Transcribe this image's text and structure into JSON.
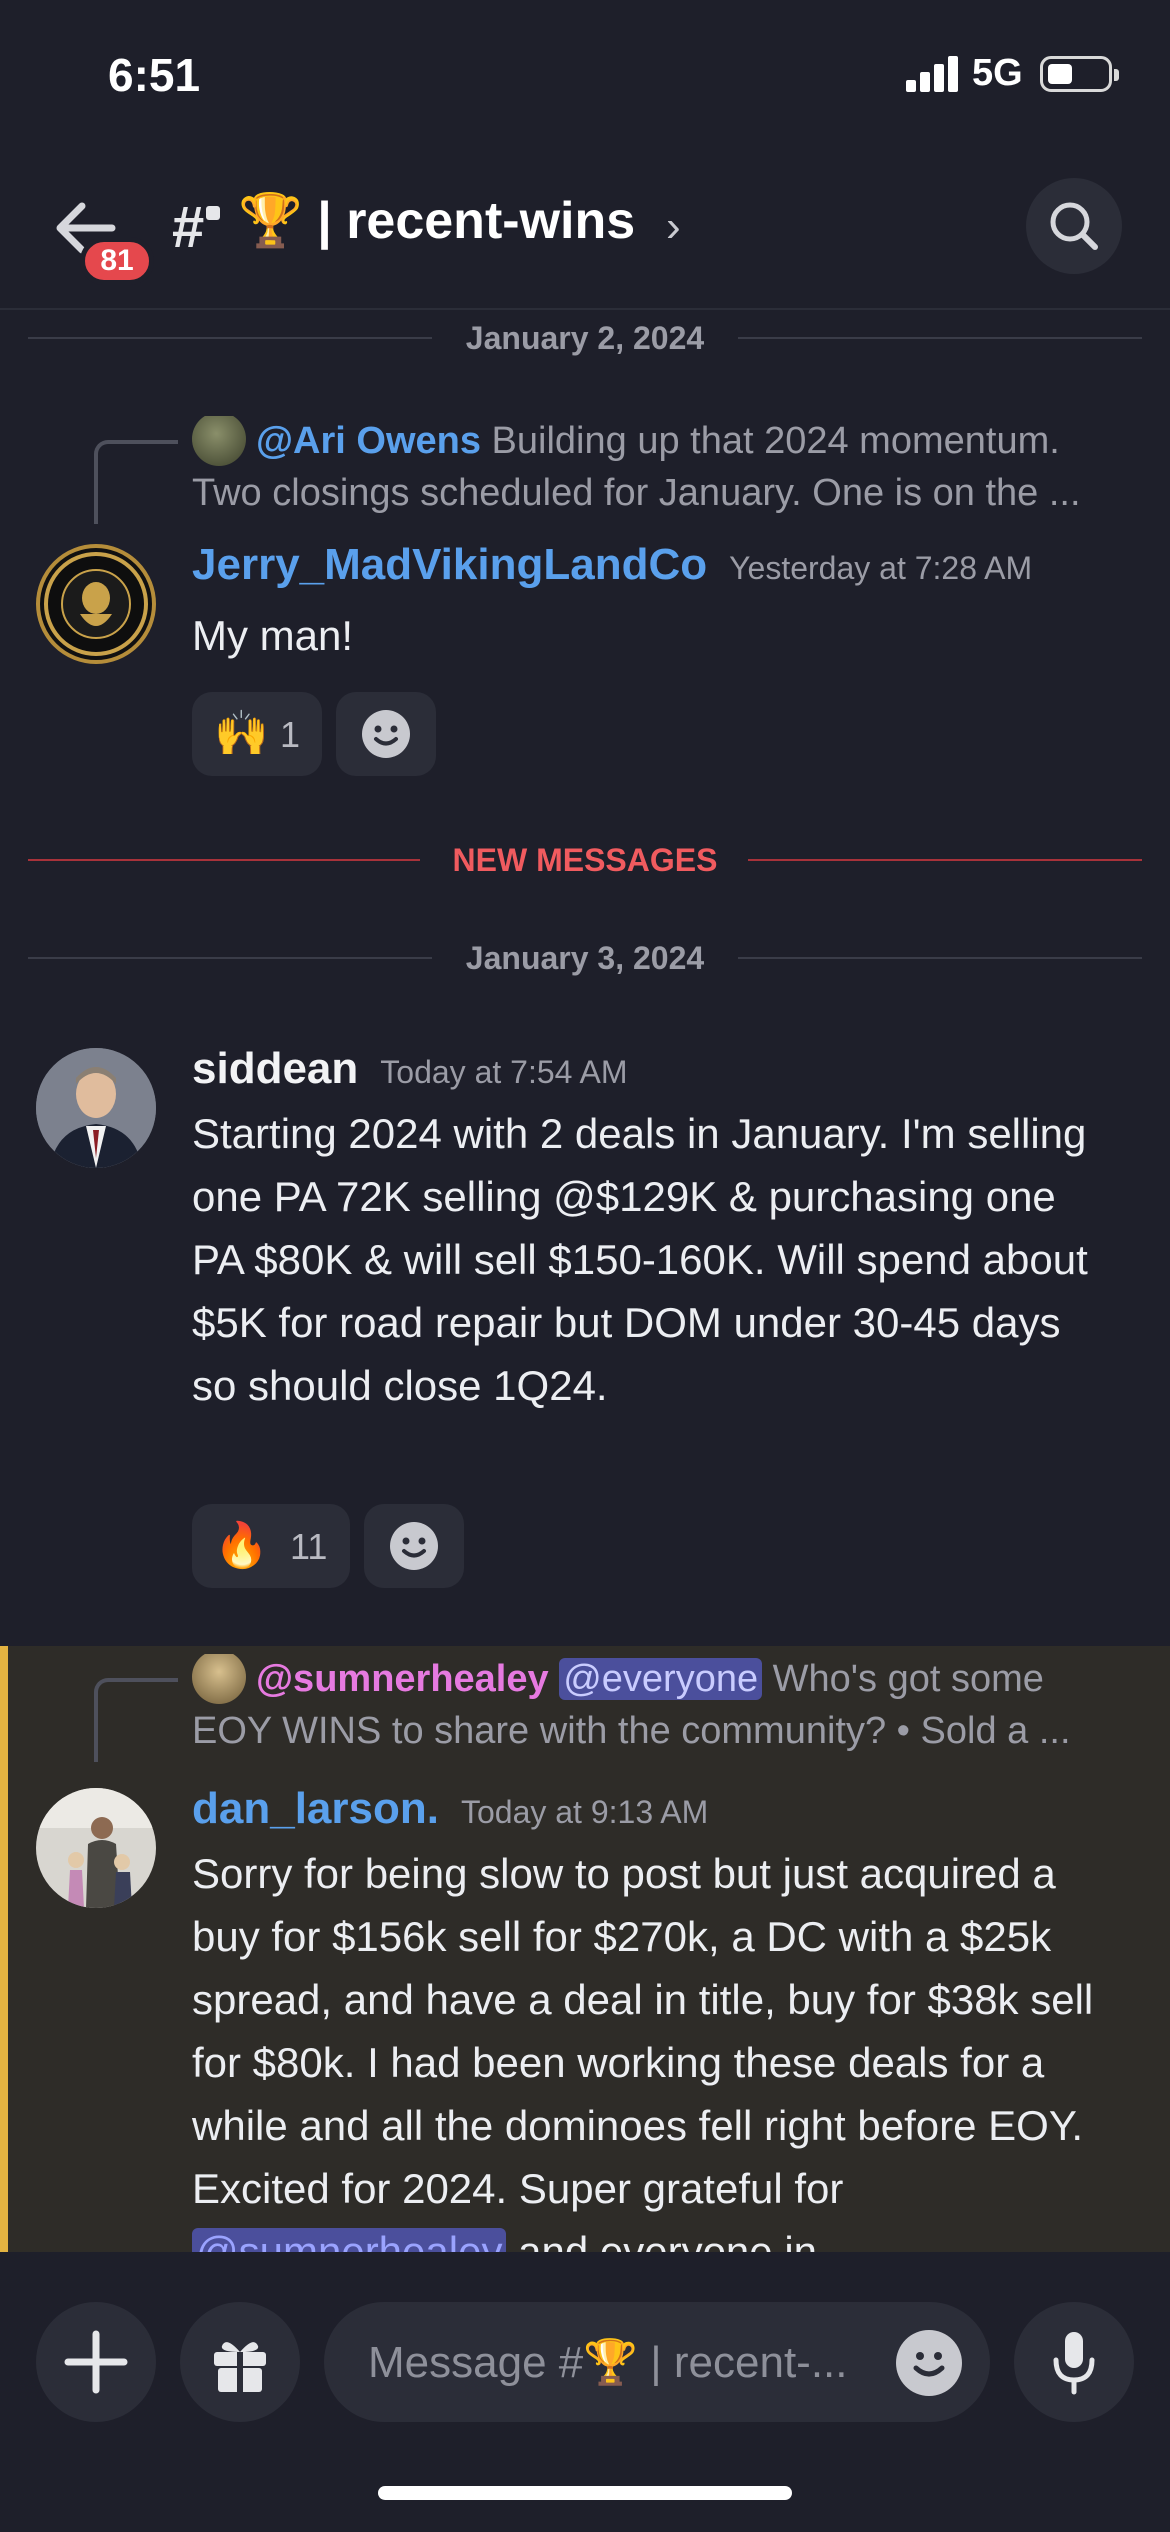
{
  "status": {
    "time": "6:51",
    "network": "5G"
  },
  "header": {
    "unread_badge": "81",
    "channel_prefix": "#",
    "channel_name": "🏆 | recent-wins",
    "chevron": "›"
  },
  "dividers": {
    "date1": "January 2, 2024",
    "new_messages": "NEW MESSAGES",
    "date2": "January 3, 2024"
  },
  "messages": [
    {
      "reply": {
        "mention": "@Ari Owens",
        "snippet1": " Building up that 2024 momentum.",
        "snippet2": "Two closings scheduled for January. One is on the ..."
      },
      "author": "Jerry_MadVikingLandCo",
      "timestamp": "Yesterday at 7:28 AM",
      "text": "My man!",
      "reactions": [
        {
          "emoji": "🙌",
          "count": "1"
        }
      ]
    },
    {
      "author": "siddean",
      "timestamp": "Today at 7:54 AM",
      "text": "Starting 2024 with  2 deals in January. I'm selling one PA 72K selling @$129K & purchasing one  PA $80K & will sell $150-160K. Will spend about $5K for road repair but DOM under 30-45 days so should close 1Q24.",
      "reactions": [
        {
          "emoji": "🔥",
          "count": "11"
        }
      ]
    },
    {
      "reply": {
        "mention": "@sumnerhealey",
        "everyone": "@everyone",
        "snippet1": " Who's got some",
        "snippet2": "EOY WINS to share with the community?  •  Sold a ..."
      },
      "author": "dan_larson.",
      "timestamp": "Today at 9:13 AM",
      "text_before": "Sorry for being slow to post but just acquired a buy for $156k sell for $270k, a DC with a $25k spread, and have a deal in title, buy for $38k sell for $80k. I had been working these deals for a while and all the dominoes fell right before EOY. Excited for 2024. Super grateful for ",
      "text_mention": "@sumnerhealey",
      "text_after": " and everyone in"
    }
  ],
  "composer": {
    "placeholder": "Message #🏆 | recent-..."
  },
  "colors": {
    "background": "#1e1f2a",
    "username_blue": "#5aa0ec",
    "mention_pink": "#e67ae0",
    "new_messages_red": "#f05b5f",
    "highlight_bar": "#e3b341",
    "badge_red": "#e5484d"
  },
  "icons": [
    "back-arrow-icon",
    "channel-hash-icon",
    "search-icon",
    "plus-icon",
    "gift-icon",
    "emoji-icon",
    "microphone-icon"
  ]
}
